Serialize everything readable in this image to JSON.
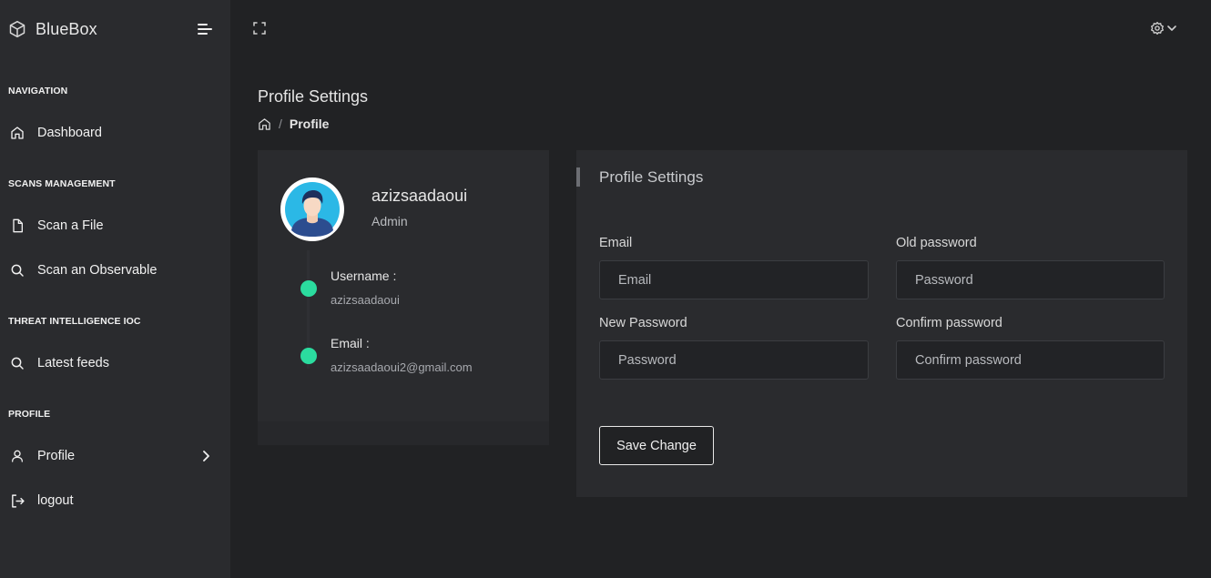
{
  "app": {
    "name": "BlueBox"
  },
  "sidebar": {
    "sections": [
      {
        "title": "NAVIGATION",
        "items": [
          {
            "label": "Dashboard",
            "icon": "home-icon"
          }
        ]
      },
      {
        "title": "SCANS MANAGEMENT",
        "items": [
          {
            "label": "Scan a File",
            "icon": "file-icon"
          },
          {
            "label": "Scan an Observable",
            "icon": "search-icon"
          }
        ]
      },
      {
        "title": "THREAT INTELLIGENCE IOC",
        "items": [
          {
            "label": "Latest feeds",
            "icon": "search-icon"
          }
        ]
      },
      {
        "title": "PROFILE",
        "items": [
          {
            "label": "Profile",
            "icon": "user-icon"
          },
          {
            "label": "logout",
            "icon": "logout-icon"
          }
        ]
      }
    ]
  },
  "page": {
    "title": "Profile Settings",
    "breadcrumb": {
      "separator": "/",
      "current": "Profile"
    }
  },
  "profile_card": {
    "username": "azizsaadaoui",
    "role": "Admin",
    "details": [
      {
        "label": "Username :",
        "value": "azizsaadaoui"
      },
      {
        "label": "Email :",
        "value": "azizsaadaoui2@gmail.com"
      }
    ]
  },
  "settings_form": {
    "title": "Profile Settings",
    "fields": {
      "email": {
        "label": "Email",
        "placeholder": "Email",
        "value": ""
      },
      "old_password": {
        "label": "Old password",
        "placeholder": "Password",
        "value": ""
      },
      "new_password": {
        "label": "New Password",
        "placeholder": "Password",
        "value": ""
      },
      "confirm_password": {
        "label": "Confirm password",
        "placeholder": "Confirm password",
        "value": ""
      }
    },
    "save_label": "Save Change"
  },
  "colors": {
    "background": "#212224",
    "panel": "#2a2b2e",
    "accent_green": "#2bdc9f",
    "text": "#e1e1e1"
  }
}
